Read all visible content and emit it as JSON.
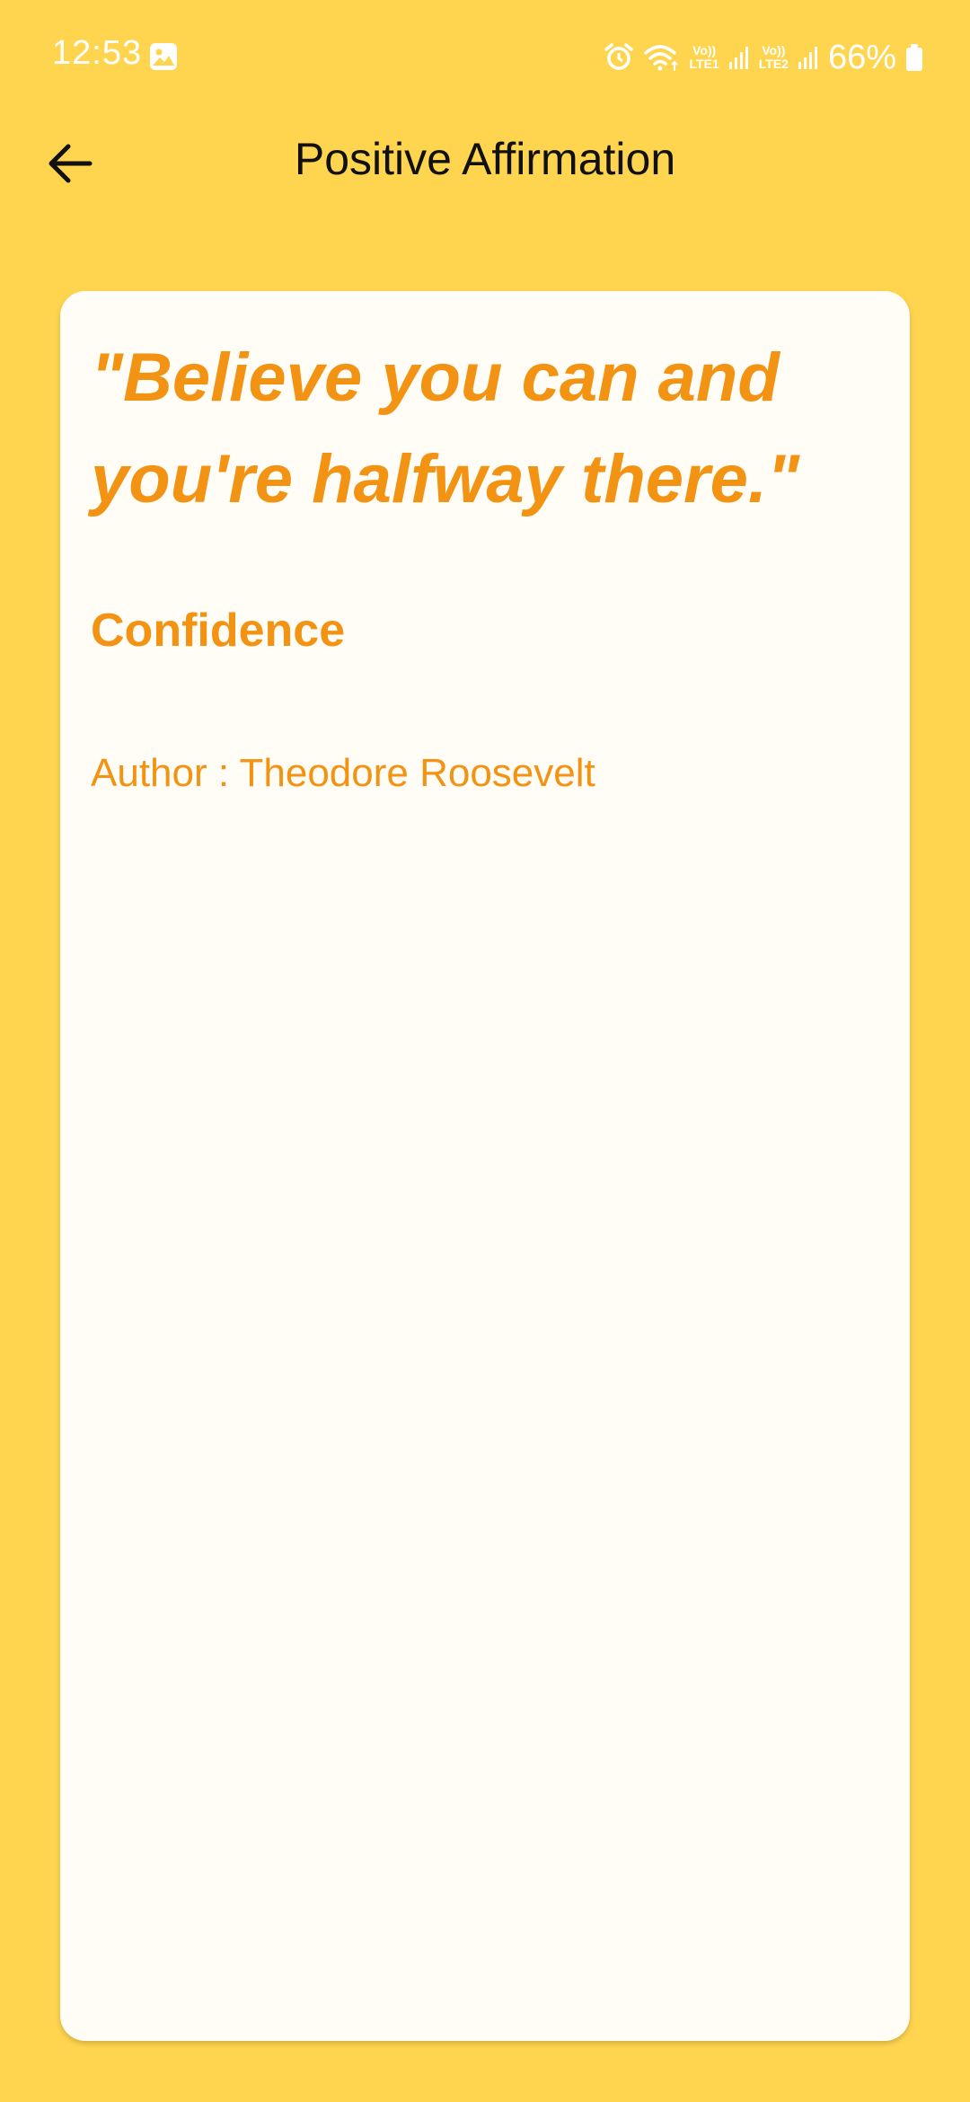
{
  "status_bar": {
    "time": "12:53",
    "network1": {
      "top": "Vo))",
      "bottom": "LTE1"
    },
    "network2": {
      "top": "Vo))",
      "bottom": "LTE2"
    },
    "battery": "66%"
  },
  "app_bar": {
    "title": "Positive Affirmation"
  },
  "card": {
    "quote": "\"Believe you can and you're halfway there.\"",
    "category": "Confidence",
    "author_prefix": "Author : ",
    "author_name": "Theodore Roosevelt"
  },
  "colors": {
    "background": "#FFD54F",
    "card": "#FFFDF6",
    "accent": "#F39313",
    "title_text": "#111111"
  },
  "icons": [
    "gallery-icon",
    "alarm-icon",
    "wifi-icon",
    "signal-icon",
    "battery-icon",
    "back-arrow-icon"
  ]
}
